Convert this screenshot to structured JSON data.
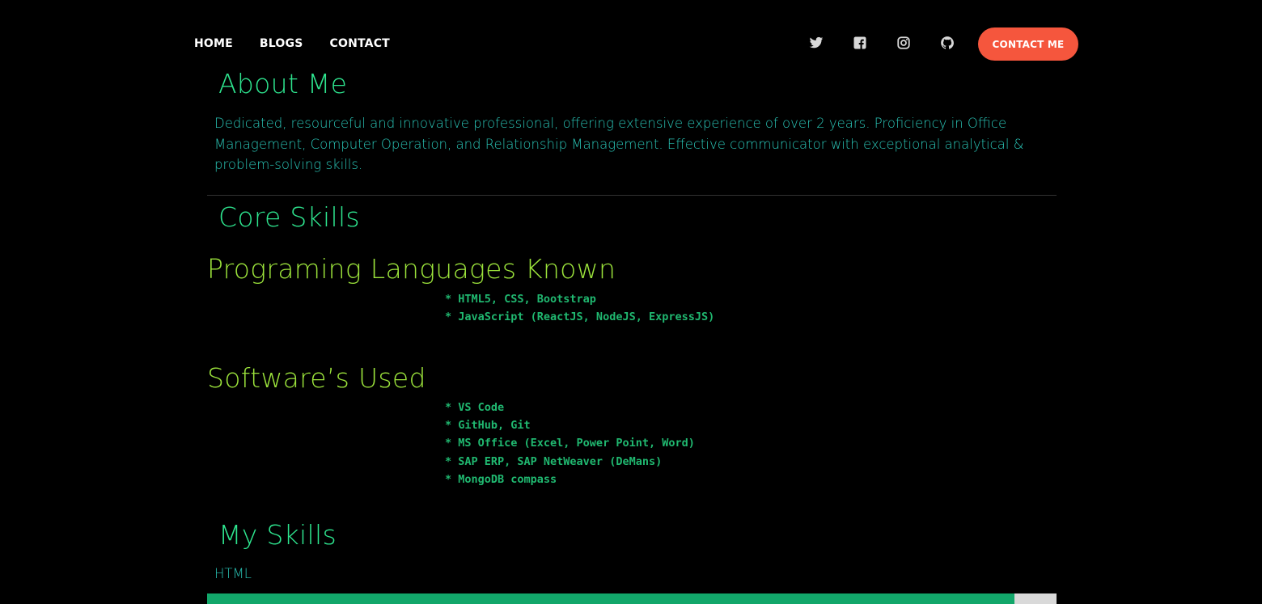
{
  "nav": {
    "links": [
      "HOME",
      "BLOGS",
      "CONTACT"
    ],
    "socials": [
      "twitter-icon",
      "facebook-icon",
      "instagram-icon",
      "github-icon"
    ],
    "cta_label": "CONTACT ME"
  },
  "about": {
    "title": "About Me",
    "text": "Dedicated, resourceful and innovative professional, offering extensive experience of over 2 years. Proficiency in Office Management, Computer Operation, and Relationship Management. Effective communicator with exceptional analytical & problem-solving skills."
  },
  "core": {
    "title": "Core Skills",
    "languages": {
      "title": "Programing Languages Known",
      "items": [
        "* HTML5, CSS, Bootstrap",
        "* JavaScript (ReactJS, NodeJS, ExpressJS)"
      ]
    },
    "software": {
      "title": "Software’s Used",
      "items": [
        "* VS Code",
        "* GitHub, Git",
        "* MS Office (Excel, Power Point, Word)",
        "* SAP ERP, SAP NetWeaver (DeMans)",
        "* MongoDB compass"
      ]
    }
  },
  "my_skills": {
    "title": "My Skills",
    "skills": [
      {
        "label": "HTML",
        "percent": 95
      }
    ]
  },
  "colors": {
    "accent": "#2ee58f",
    "subheading": "#9be23b",
    "body_text": "#2ac4b6",
    "list_text": "#20b870",
    "cta": "#f5563d",
    "progress": "#12a76a"
  }
}
